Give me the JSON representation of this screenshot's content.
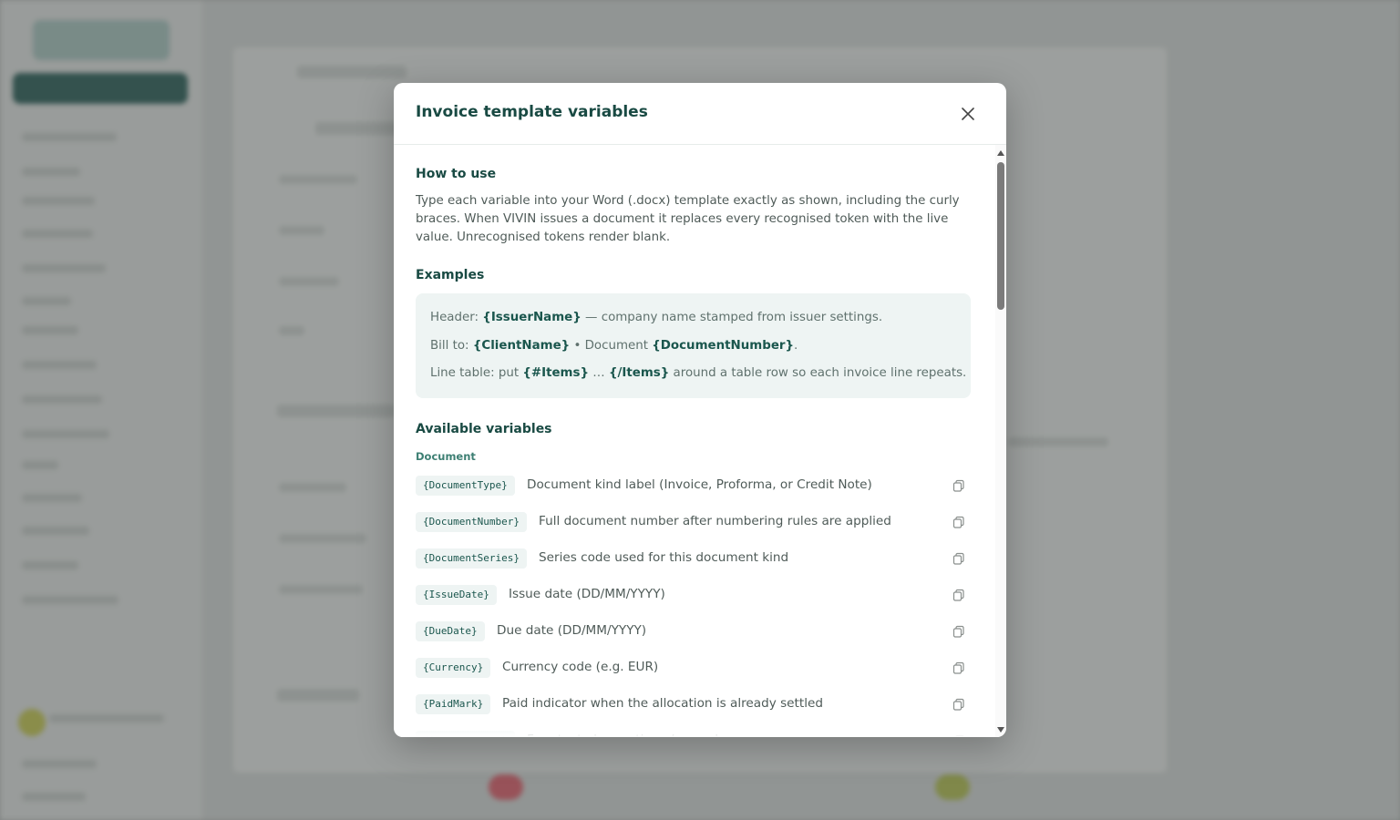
{
  "modal": {
    "title": "Invoice template variables",
    "close_icon": "close-icon",
    "how_to_use": {
      "heading": "How to use",
      "text": "Type each variable into your Word (.docx) template exactly as shown, including the curly braces. When VIVIN issues a document it replaces every recognised token with the live value. Unrecognised tokens render blank."
    },
    "examples": {
      "heading": "Examples",
      "line1": {
        "prefix": "Header: ",
        "token": "{IssuerName}",
        "suffix": " — company name stamped from issuer settings."
      },
      "line2": {
        "prefix": "Bill to: ",
        "token1": "{ClientName}",
        "middle": " • Document ",
        "token2": "{DocumentNumber}",
        "suffix": "."
      },
      "line3": {
        "prefix": "Line table: put ",
        "token1": "{#Items}",
        "middle": " … ",
        "token2": "{/Items}",
        "suffix": " around a table row so each invoice line repeats."
      }
    },
    "available": {
      "heading": "Available variables",
      "group": "Document",
      "variables": [
        {
          "token": "{DocumentType}",
          "description": "Document kind label (Invoice, Proforma, or Credit Note)"
        },
        {
          "token": "{DocumentNumber}",
          "description": "Full document number after numbering rules are applied"
        },
        {
          "token": "{DocumentSeries}",
          "description": "Series code used for this document kind"
        },
        {
          "token": "{IssueDate}",
          "description": "Issue date (DD/MM/YYYY)"
        },
        {
          "token": "{DueDate}",
          "description": "Due date (DD/MM/YYYY)"
        },
        {
          "token": "{Currency}",
          "description": "Currency code (e.g. EUR)"
        },
        {
          "token": "{PaidMark}",
          "description": "Paid indicator when the allocation is already settled"
        },
        {
          "token": "{Observations}",
          "description": "Free-text observations / remarks"
        }
      ],
      "copy_icon": "copy-icon"
    }
  },
  "colors": {
    "heading": "#194a43",
    "token": "#1a564d",
    "chip_bg": "#eef4f3",
    "body_text": "#4f5b58"
  }
}
